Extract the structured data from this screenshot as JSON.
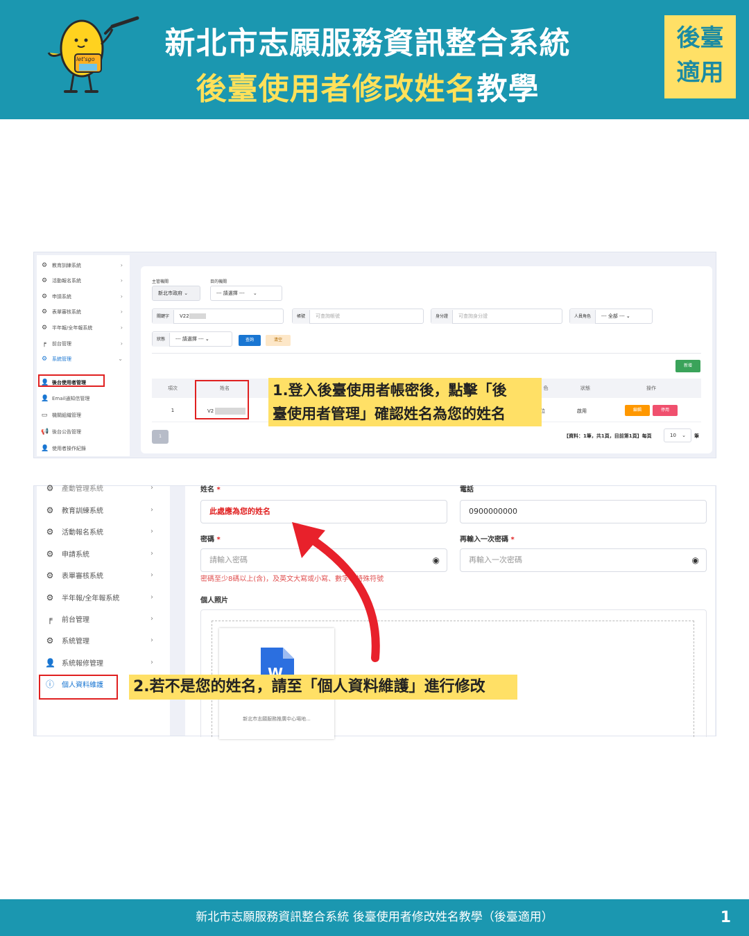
{
  "header": {
    "title_line1": "新北市志願服務資訊整合系統",
    "title_line2_highlight": "後臺使用者修改姓名",
    "title_line2_rest": "教學",
    "badge_line1": "後臺",
    "badge_line2": "適用",
    "mascot_text": "let'sgo"
  },
  "screen1": {
    "sidebar": [
      {
        "label": "教育訓練系統",
        "icon": "gear-icon"
      },
      {
        "label": "活動報名系統",
        "icon": "gear-icon"
      },
      {
        "label": "申請系統",
        "icon": "gear-icon"
      },
      {
        "label": "表單審核系統",
        "icon": "gear-icon"
      },
      {
        "label": "半年報/全年報系統",
        "icon": "gear-icon"
      },
      {
        "label": "前台管理",
        "icon": "paint-roller-icon"
      },
      {
        "label": "系統管理",
        "icon": "gear-icon"
      },
      {
        "label": "後台使用者管理",
        "icon": "user-icon"
      },
      {
        "label": "Email通知信管理",
        "icon": "user-icon"
      },
      {
        "label": "機關組織管理",
        "icon": "briefcase-icon"
      },
      {
        "label": "後台公告管理",
        "icon": "megaphone-icon"
      },
      {
        "label": "使用者操作紀錄",
        "icon": "user-icon"
      }
    ],
    "filters": {
      "agency_label": "主管機關",
      "agency_value": "新北市政府",
      "target_label": "目的機關",
      "target_value": "--- 請選擇 ---",
      "keyword_label": "關鍵字",
      "keyword_value": "V22",
      "account_label": "帳號",
      "account_placeholder": "可查詢帳號",
      "id_label": "身分證",
      "id_placeholder": "可查詢身分證",
      "role_label": "人員角色",
      "role_value": "--- 全部 ---",
      "status_label": "狀態",
      "status_value": "--- 請選擇 ---",
      "search_button": "查詢",
      "clear_button": "清空",
      "add_button": "新增"
    },
    "table": {
      "headers": [
        "項次",
        "姓名",
        "色",
        "狀態",
        "操作"
      ],
      "row": {
        "index": "1",
        "name": "V2",
        "role": "位",
        "status": "啟用",
        "edit": "編輯",
        "disable": "停用"
      }
    },
    "pagination": {
      "page": "1",
      "info": "【資料：1筆，共1頁，目前第1頁】每頁",
      "per_page": "10",
      "unit": "筆"
    },
    "callout_line1": "1.登入後臺使用者帳密後，點擊「後",
    "callout_line2": "臺使用者管理」確認姓名為您的姓名"
  },
  "screen2": {
    "sidebar_top_cut": "產動管理系統",
    "sidebar": [
      {
        "label": "教育訓練系統",
        "icon": "gear-icon"
      },
      {
        "label": "活動報名系統",
        "icon": "gear-icon"
      },
      {
        "label": "申請系統",
        "icon": "gear-icon"
      },
      {
        "label": "表單審核系統",
        "icon": "gear-icon"
      },
      {
        "label": "半年報/全年報系統",
        "icon": "gear-icon"
      },
      {
        "label": "前台管理",
        "icon": "paint-roller-icon"
      },
      {
        "label": "系統管理",
        "icon": "gear-icon"
      },
      {
        "label": "系統報修管理",
        "icon": "user-icon"
      },
      {
        "label": "個人資料維護",
        "icon": "info-icon"
      }
    ],
    "form": {
      "name_label": "姓名",
      "name_value": "此處應為您的姓名",
      "phone_label": "電話",
      "phone_value": "0900000000",
      "password_label": "密碼",
      "password_placeholder": "請輸入密碼",
      "confirm_label": "再輸入一次密碼",
      "confirm_placeholder": "再輸入一次密碼",
      "password_hint": "密碼至少8碼以上(含)，及英文大寫或小寫、數字、特殊符號",
      "photo_label": "個人照片",
      "file_caption": "新北市志願服務推廣中心場地..."
    },
    "callout": "2.若不是您的姓名，請至「個人資料維護」進行修改"
  },
  "footer": {
    "text": "新北市志願服務資訊整合系統 後臺使用者修改姓名教學（後臺適用）",
    "page_number": "1"
  },
  "colors": {
    "brand_teal": "#1b97b0",
    "highlight_yellow": "#ffe066",
    "alert_red": "#e02020",
    "link_blue": "#1976d2"
  }
}
